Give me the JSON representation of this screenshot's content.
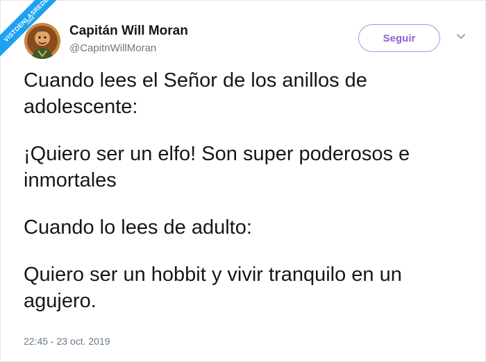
{
  "watermark": {
    "text": "VISTOENLASREDES",
    "sub": ".com"
  },
  "user": {
    "name": "Capitán Will Moran",
    "handle": "@CapitnWillMoran"
  },
  "actions": {
    "follow_label": "Seguir",
    "accent_color": "#8a63d2"
  },
  "tweet": {
    "paragraphs": [
      "Cuando lees el Señor de los anillos de adolescente:",
      "¡Quiero ser un elfo! Son super poderosos e inmortales",
      "Cuando lo lees de adulto:",
      "Quiero ser un hobbit y vivir tranquilo en un agujero."
    ],
    "timestamp": "22:45 - 23 oct. 2019"
  },
  "icons": {
    "avatar": "avatar-portrait",
    "menu": "chevron-down-icon"
  }
}
